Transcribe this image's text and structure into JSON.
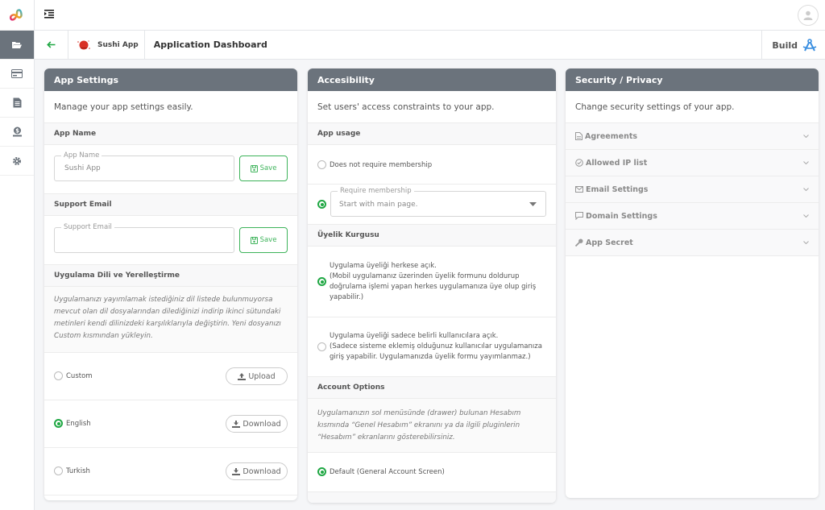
{
  "rail": {
    "items": [
      {
        "name": "projects",
        "icon": "folder-open-icon",
        "active": true
      },
      {
        "name": "billing",
        "icon": "credit-card-icon",
        "active": false
      },
      {
        "name": "documents",
        "icon": "document-icon",
        "active": false
      },
      {
        "name": "payments",
        "icon": "money-icon",
        "active": false
      },
      {
        "name": "settings",
        "icon": "gear-icon",
        "active": false
      }
    ]
  },
  "subbar": {
    "app_name": "Sushi App",
    "title": "Application Dashboard",
    "build_label": "Build"
  },
  "app_settings": {
    "header": "App Settings",
    "description": "Manage your app settings easily.",
    "app_name_section": "App Name",
    "app_name_legend": "App Name",
    "app_name_value": "Sushi App",
    "save_label": "Save",
    "support_email_section": "Support Email",
    "support_email_legend": "Support Email",
    "support_email_value": "",
    "localization_section": "Uygulama Dili ve Yerelleştirme",
    "localization_note": "Uygulamanızı yayımlamak istediğiniz dil listede bulunmuyorsa mevcut olan dil dosyalarından dilediğinizi indirip ikinci sütundaki metinleri kendi dilinizdeki karşılıklarıyla değiştirin. Yeni dosyanızı Custom kısmından yükleyin.",
    "languages": [
      {
        "label": "Custom",
        "checked": false,
        "action": "Upload",
        "action_icon": "upload-icon"
      },
      {
        "label": "English",
        "checked": true,
        "action": "Download",
        "action_icon": "download-icon"
      },
      {
        "label": "Turkish",
        "checked": false,
        "action": "Download",
        "action_icon": "download-icon"
      }
    ]
  },
  "accessibility": {
    "header": "Accesibility",
    "description": "Set users' access constraints to your app.",
    "app_usage_section": "App usage",
    "no_membership_label": "Does not require membership",
    "no_membership_checked": false,
    "require_membership_legend": "Require membership",
    "require_membership_value": "Start with main page.",
    "require_membership_checked": true,
    "membership_section": "Üyelik Kurgusu",
    "membership_options": [
      {
        "lines": [
          "Uygulama üyeliği herkese açık.",
          "(Mobil uygulamanız üzerinden üyelik formunu doldurup",
          "doğrulama işlemi yapan herkes uygulamanıza üye olup giriş",
          "yapabilir.)"
        ],
        "checked": true
      },
      {
        "lines": [
          "Uygulama üyeliği sadece belirli kullanıcılara açık.",
          "(Sadece sisteme eklemiş olduğunuz kullanıcılar uygulamanıza",
          "giriş yapabilir. Uygulamanızda üyelik formu yayımlanmaz.)"
        ],
        "checked": false
      }
    ],
    "account_section": "Account Options",
    "account_note": "Uygulamanızın sol menüsünde (drawer) bulunan Hesabım kısmında “Genel Hesabım” ekranını ya da ilgili pluginlerin “Hesabım” ekranlarını gösterebilirsiniz.",
    "account_default_label": "Default (General Account Screen)",
    "account_default_checked": true
  },
  "security": {
    "header": "Security / Privacy",
    "description": "Change security settings of your app.",
    "items": [
      {
        "label": "Agreements",
        "icon": "document-icon"
      },
      {
        "label": "Allowed IP list",
        "icon": "check-circle-icon"
      },
      {
        "label": "Email Settings",
        "icon": "envelope-icon"
      },
      {
        "label": "Domain Settings",
        "icon": "comment-icon"
      },
      {
        "label": "App Secret",
        "icon": "key-icon"
      }
    ]
  },
  "colors": {
    "header_gray": "#6b737c",
    "accent_green": "#1fa743",
    "build_blue": "#3b8fe0"
  }
}
